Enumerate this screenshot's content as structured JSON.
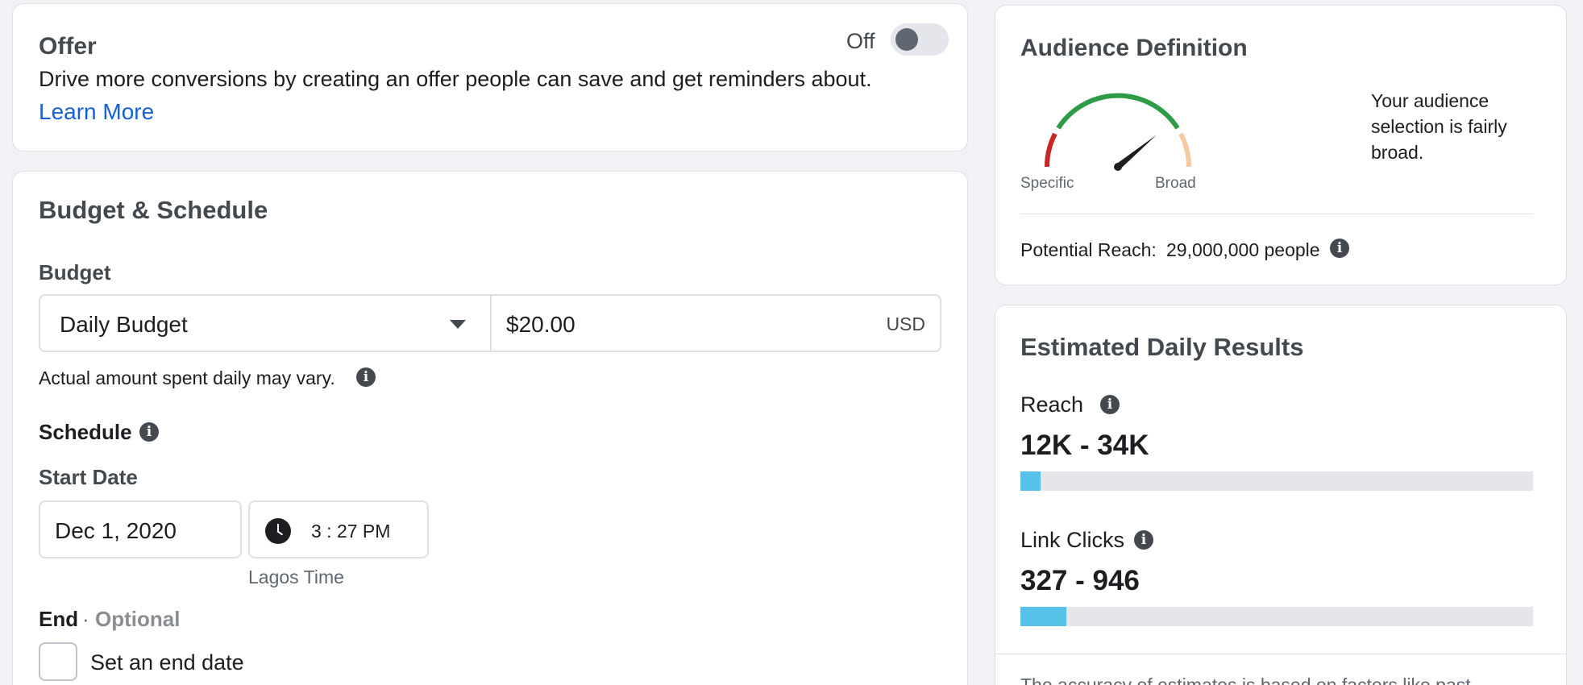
{
  "offer": {
    "title": "Offer",
    "description": "Drive more conversions by creating an offer people can save and get reminders about.",
    "learn_more": "Learn More",
    "toggle_state": "Off"
  },
  "budget_schedule": {
    "title": "Budget & Schedule",
    "budget_label": "Budget",
    "budget_type": "Daily Budget",
    "amount": "$20.00",
    "currency": "USD",
    "note": "Actual amount spent daily may vary.",
    "schedule_label": "Schedule",
    "start_date_label": "Start Date",
    "start_date": "Dec 1, 2020",
    "start_time": "3 : 27 PM",
    "time_zone": "Lagos Time",
    "end_label": "End",
    "end_separator": "·",
    "end_optional": "Optional",
    "end_checkbox_label": "Set an end date"
  },
  "audience": {
    "title": "Audience Definition",
    "gauge_left_label": "Specific",
    "gauge_right_label": "Broad",
    "message": "Your audience selection is fairly broad.",
    "potential_reach_label": "Potential Reach:",
    "potential_reach_value": "29,000,000 people",
    "gauge_level": 0.78
  },
  "estimates": {
    "title": "Estimated Daily Results",
    "reach_label": "Reach",
    "reach_range": "12K - 34K",
    "reach_bar_fill": 0.04,
    "clicks_label": "Link Clicks",
    "clicks_range": "327 - 946",
    "clicks_bar_fill": 0.09,
    "footnote": "The accuracy of estimates is based on factors like past"
  },
  "colors": {
    "link": "#1660d5",
    "bar_fill": "#58c3ea",
    "gauge_red": "#c62828",
    "gauge_green": "#2e9b46",
    "gauge_peach": "#f7c9a0"
  },
  "icons": {
    "info": "info-icon",
    "clock": "clock-icon",
    "caret": "caret-down-icon"
  }
}
